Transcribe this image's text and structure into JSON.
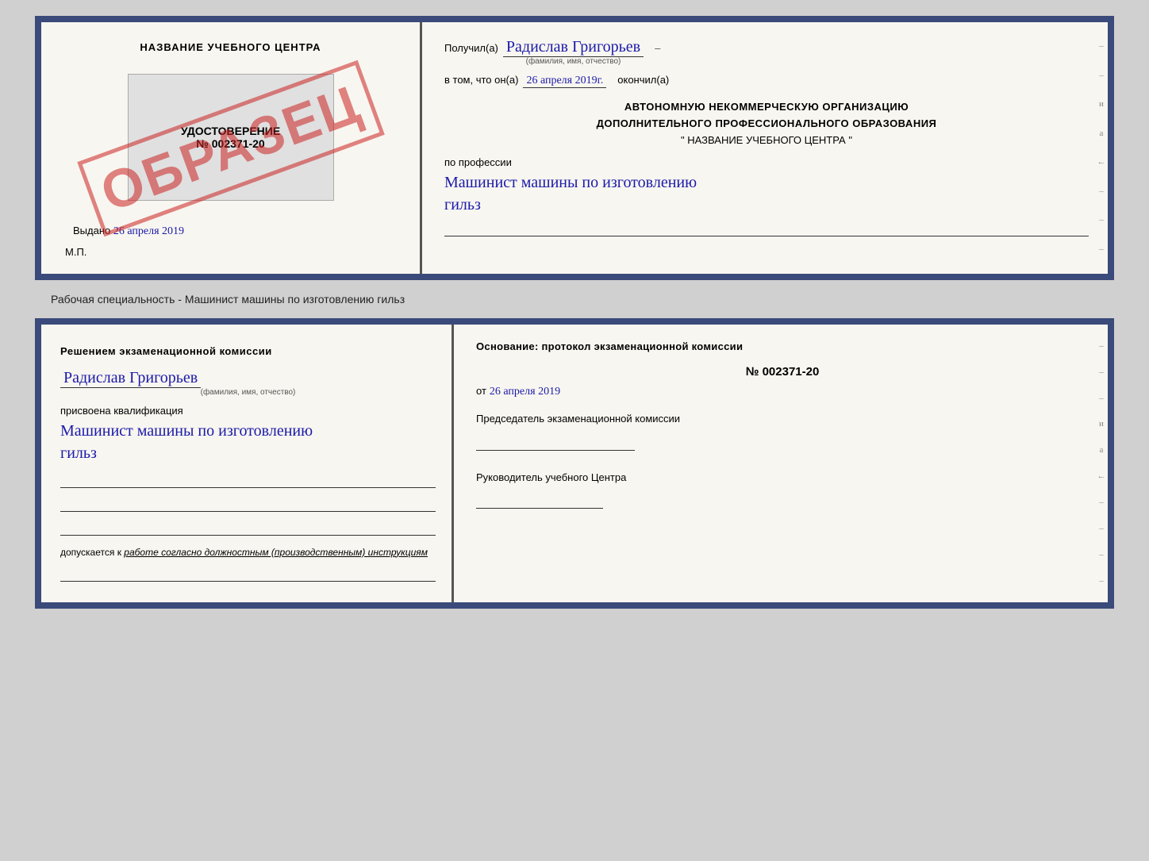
{
  "page": {
    "background": "#d0d0d0"
  },
  "top_doc": {
    "left": {
      "title": "НАЗВАНИЕ УЧЕБНОГО ЦЕНТРА",
      "udostoverenie_label": "УДОСТОВЕРЕНИЕ",
      "number": "№ 002371-20",
      "vydano_prefix": "Выдано",
      "vydano_date": "26 апреля 2019",
      "mp": "М.П.",
      "stamp": "ОБРАЗЕЦ"
    },
    "right": {
      "poluchil_prefix": "Получил(а)",
      "recipient_name": "Радислав Григорьев",
      "fio_caption": "(фамилия, имя, отчество)",
      "dash1": "–",
      "vtom_prefix": "в том, что он(а)",
      "vtom_date": "26 апреля 2019г.",
      "okonchil": "окончил(а)",
      "dash2": "–",
      "org_line1": "АВТОНОМНУЮ НЕКОММЕРЧЕСКУЮ ОРГАНИЗАЦИЮ",
      "org_line2": "ДОПОЛНИТЕЛЬНОГО ПРОФЕССИОНАЛЬНОГО ОБРАЗОВАНИЯ",
      "org_line3": "\"   НАЗВАНИЕ УЧЕБНОГО ЦЕНТРА   \"",
      "dash3": "–",
      "i_char": "и",
      "a_char": "а",
      "left_arrow": "←",
      "po_professii": "по профессии",
      "profession_line1": "Машинист машины по изготовлению",
      "profession_line2": "гильз",
      "dash_lines": [
        "–",
        "–",
        "–",
        "–"
      ]
    }
  },
  "between": {
    "label": "Рабочая специальность - Машинист машины по изготовлению гильз"
  },
  "bottom_doc": {
    "left": {
      "title": "Решением  экзаменационной  комиссии",
      "name": "Радислав Григорьев",
      "fio_caption": "(фамилия, имя, отчество)",
      "prisvoena": "присвоена квалификация",
      "kvalif_line1": "Машинист машины по изготовлению",
      "kvalif_line2": "гильз",
      "dopuskaetsya_prefix": "допускается к",
      "dopuskaetsya_text": "работе согласно должностным (производственным) инструкциям"
    },
    "right": {
      "osnov_title": "Основание: протокол экзаменационной  комиссии",
      "number": "№  002371-20",
      "date_prefix": "от",
      "date": "26 апреля 2019",
      "predsedatel_title": "Председатель экзаменационной комиссии",
      "rukovoditel_title": "Руководитель учебного Центра",
      "dash_items": [
        "–",
        "–",
        "–",
        "и",
        "а",
        "←",
        "–",
        "–",
        "–",
        "–"
      ]
    }
  }
}
